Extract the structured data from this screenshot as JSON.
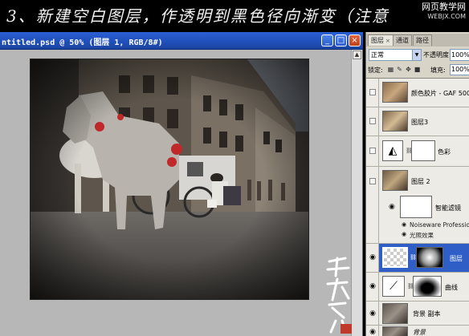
{
  "banner": {
    "text": "3、新建空白图层，作透明到黑色径向渐变（注意",
    "watermark_title": "网页教学网",
    "watermark_url": "WEBJX.COM"
  },
  "document": {
    "title": "ntitled.psd @ 50% (图层 1, RGB/8#)",
    "buttons": {
      "minimize": "_",
      "maximize": "□",
      "close": "×"
    }
  },
  "layers_panel": {
    "tabs": [
      {
        "label": "图层",
        "close": "×"
      },
      {
        "label": "通道"
      },
      {
        "label": "路径"
      }
    ],
    "blend_mode": "正常",
    "opacity_label": "不透明度:",
    "opacity_value": "100%",
    "lock_label": "锁定:",
    "fill_label": "填充:",
    "fill_value": "100%",
    "layers": [
      {
        "name": "颜色胶片 - GAF 500",
        "visible": false,
        "selected": false
      },
      {
        "name": "图层3",
        "visible": false,
        "selected": false
      },
      {
        "name": "色彩",
        "visible": false,
        "selected": false
      },
      {
        "name": "图层 2",
        "visible": false,
        "selected": false
      },
      {
        "name": "智能滤镜",
        "visible": true,
        "selected": false
      },
      {
        "name": "图层",
        "visible": true,
        "selected": true
      },
      {
        "name": "曲线",
        "visible": true,
        "selected": false
      },
      {
        "name": "背景 副本",
        "visible": true,
        "selected": false
      },
      {
        "name": "背景",
        "visible": true,
        "selected": false
      }
    ],
    "smart_filters": [
      {
        "name": "Noiseware Professional"
      },
      {
        "name": "光照效果"
      }
    ]
  },
  "colors": {
    "titlebar": "#1f4fb8",
    "selected_layer": "#2f5fc6",
    "workspace": "#b7b7b7"
  }
}
